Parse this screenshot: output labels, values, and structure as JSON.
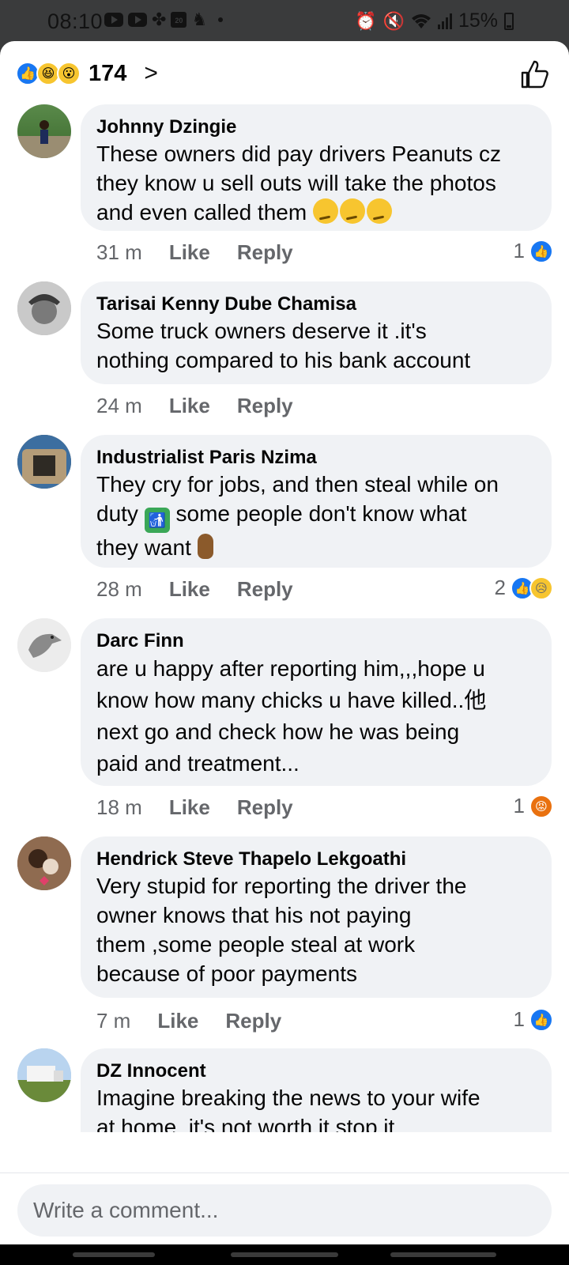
{
  "status_bar": {
    "time": "08:10",
    "battery": "15%",
    "calendar_day": "20"
  },
  "header": {
    "reaction_count": "174"
  },
  "comments": [
    {
      "author": "Johnny Dzingie",
      "lines": [
        "These owners did pay drivers Peanuts cz",
        "they know u sell outs will take the photos",
        "and even called them"
      ],
      "time": "31 m",
      "like": "Like",
      "reply": "Reply",
      "reactions_count": "1"
    },
    {
      "author": "Tarisai Kenny Dube Chamisa",
      "lines": [
        "Some truck owners deserve it .it's",
        "nothing compared to his bank account"
      ],
      "time": "24 m",
      "like": "Like",
      "reply": "Reply",
      "reactions_count": ""
    },
    {
      "author": "Industrialist Paris Nzima",
      "lines": [
        "They cry for jobs, and then steal while on",
        "some people don't know what",
        "they want"
      ],
      "line2_prefix": "duty",
      "time": "28 m",
      "like": "Like",
      "reply": "Reply",
      "reactions_count": "2"
    },
    {
      "author": "Darc Finn",
      "lines": [
        "are u happy after reporting him,,,hope u",
        "know how many chicks u have killed..他",
        "next go and check how he was being",
        "paid and treatment..."
      ],
      "time": "18 m",
      "like": "Like",
      "reply": "Reply",
      "reactions_count": "1"
    },
    {
      "author": "Hendrick Steve Thapelo Lekgoathi",
      "lines": [
        "Very stupid for reporting the driver the",
        "owner knows that his not paying",
        "them ,some people steal at work",
        "because of poor payments"
      ],
      "time": "7 m",
      "like": "Like",
      "reply": "Reply",
      "reactions_count": "1"
    },
    {
      "author": "DZ Innocent",
      "lines": [
        "Imagine breaking the news to your wife",
        "at home, it's not worth it stop it."
      ],
      "time": "",
      "like": "",
      "reply": "",
      "reactions_count": ""
    }
  ],
  "composer": {
    "placeholder": "Write a comment..."
  },
  "colors": {
    "accent": "#1877f2",
    "bubble": "#f0f2f5",
    "meta": "#65676b",
    "angry": "#e9710f"
  },
  "icons": [
    "youtube-icon",
    "fan-icon",
    "calendar-icon",
    "alarm-icon",
    "mute-icon",
    "wifi-icon",
    "signal-icon",
    "battery-icon",
    "like-reaction-icon",
    "haha-reaction-icon",
    "wow-reaction-icon",
    "sad-reaction-icon",
    "angry-reaction-icon",
    "chevron-right-icon",
    "thumbs-up-icon"
  ]
}
